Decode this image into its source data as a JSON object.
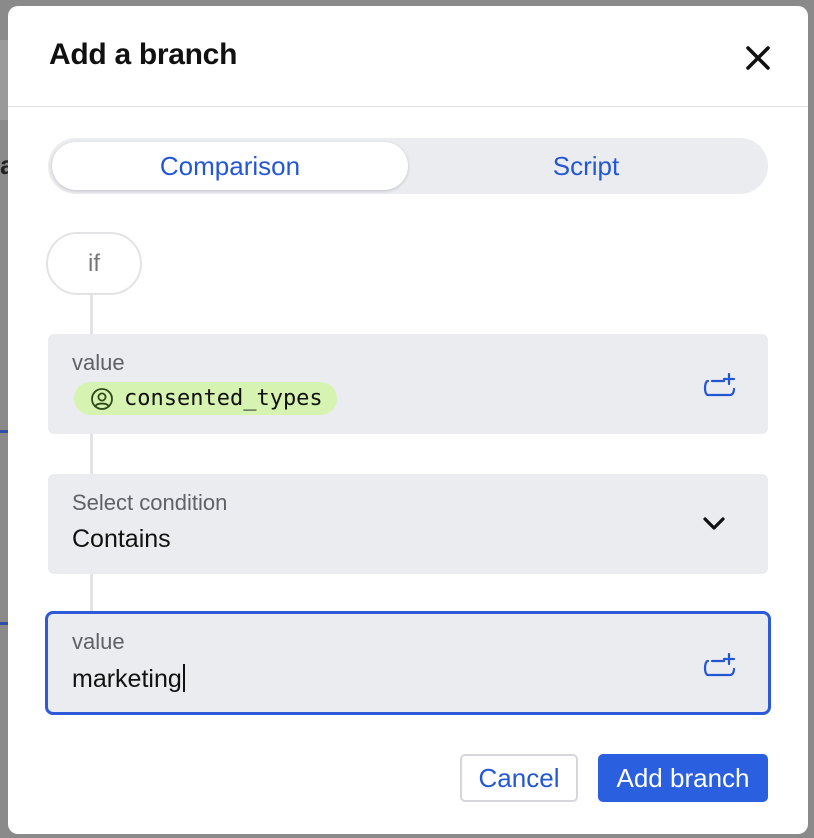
{
  "modal": {
    "title": "Add a branch",
    "close_icon": "close-icon"
  },
  "mode_tabs": [
    {
      "label": "Comparison",
      "active": true
    },
    {
      "label": "Script",
      "active": false
    }
  ],
  "if_label": "if",
  "left_operand": {
    "label": "value",
    "token": {
      "icon": "user-circle-icon",
      "text": "consented_types"
    },
    "add_icon": "add-variable-icon"
  },
  "condition": {
    "label": "Select condition",
    "value": "Contains",
    "icon": "chevron-down-icon"
  },
  "right_operand": {
    "label": "value",
    "value": "marketing",
    "add_icon": "add-variable-icon"
  },
  "footer": {
    "cancel_label": "Cancel",
    "submit_label": "Add branch"
  },
  "colors": {
    "accent": "#2a5fe0",
    "token_bg": "#d6f3b1",
    "field_bg": "#ebecf0",
    "focus_border": "#2d5ad8"
  }
}
